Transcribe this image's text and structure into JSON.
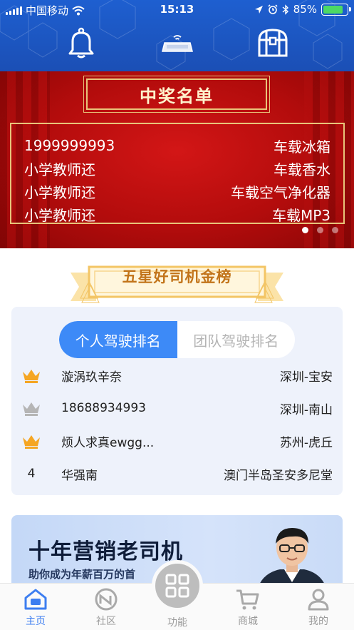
{
  "status_bar": {
    "carrier": "中国移动",
    "time": "15:13",
    "battery_percent": "85%",
    "battery_level": 0.85
  },
  "header": {
    "icons": [
      "bell-icon",
      "device-icon",
      "treasure-chest-icon"
    ]
  },
  "banner": {
    "title": "中奖名单",
    "winners": [
      {
        "name": "1999999993",
        "prize": "车载冰箱"
      },
      {
        "name": "小学教师还",
        "prize": "车载香水"
      },
      {
        "name": "小学教师还",
        "prize": "车载空气净化器"
      },
      {
        "name": "小学教师还",
        "prize": "车载MP3"
      }
    ],
    "page_count": 3,
    "active_page": 0
  },
  "ranking": {
    "title": "五星好司机金榜",
    "tabs": [
      "个人驾驶排名",
      "团队驾驶排名"
    ],
    "active_tab": 0,
    "rows": [
      {
        "rank": "1",
        "badge": "gold",
        "name": "漩涡玖辛奈",
        "city": "深圳-宝安"
      },
      {
        "rank": "2",
        "badge": "silver",
        "name": "18688934993",
        "city": "深圳-南山"
      },
      {
        "rank": "3",
        "badge": "gold",
        "name": "烦人求真ewgg...",
        "city": "苏州-虎丘"
      },
      {
        "rank": "4",
        "badge": "",
        "name": "华强南",
        "city": "澳门半岛圣安多尼堂"
      }
    ],
    "colors": {
      "gold": "#f5a623",
      "silver": "#b5b5b5",
      "accent": "#3d8af7"
    }
  },
  "promo": {
    "title": "十年营销老司机",
    "subtitle": "助你成为年薪百万的首"
  },
  "tabbar": {
    "items": [
      {
        "label": "主页",
        "icon": "home-icon",
        "active": true
      },
      {
        "label": "社区",
        "icon": "community-icon",
        "active": false
      },
      {
        "label": "功能",
        "icon": "grid-icon",
        "active": false
      },
      {
        "label": "商城",
        "icon": "cart-icon",
        "active": false
      },
      {
        "label": "我的",
        "icon": "person-icon",
        "active": false
      }
    ],
    "active_color": "#3d7ef0"
  }
}
